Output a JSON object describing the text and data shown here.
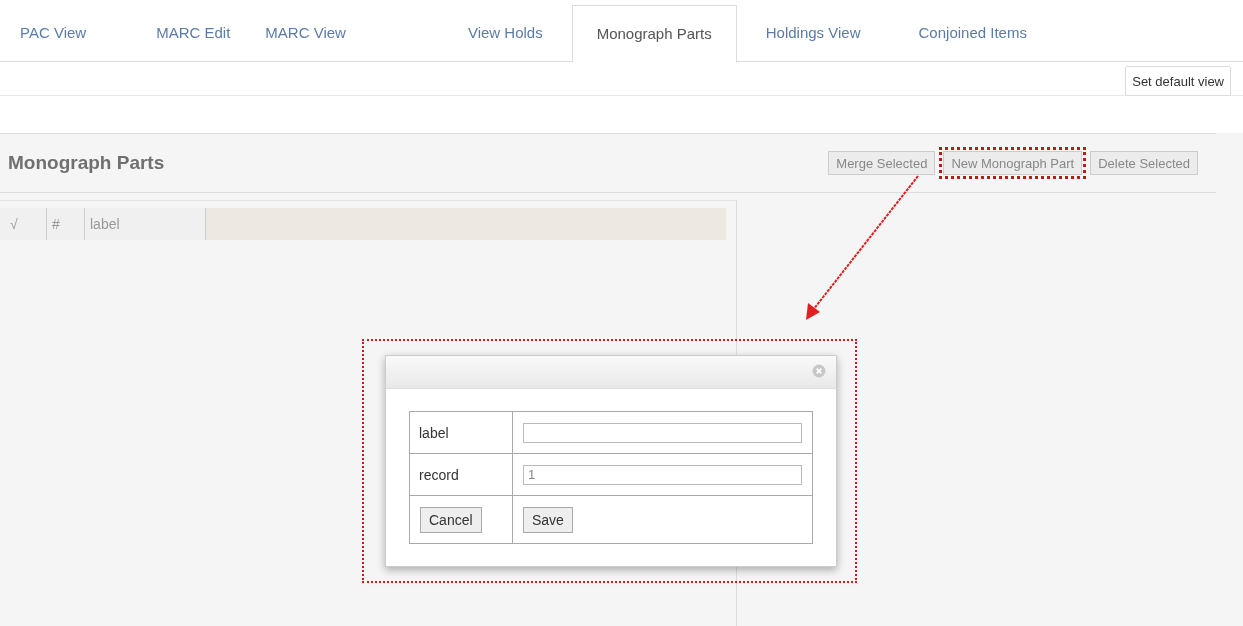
{
  "tabs": [
    {
      "label": "PAC View",
      "selected": false
    },
    {
      "label": "MARC Edit",
      "selected": false
    },
    {
      "label": "MARC View",
      "selected": false
    },
    {
      "label": "View Holds",
      "selected": false
    },
    {
      "label": "Monograph Parts",
      "selected": true
    },
    {
      "label": "Holdings View",
      "selected": false
    },
    {
      "label": "Conjoined Items",
      "selected": false
    }
  ],
  "default_view_button": "Set default view",
  "panel": {
    "title": "Monograph Parts",
    "buttons": [
      {
        "label": "Merge Selected",
        "highlighted": false
      },
      {
        "label": "New Monograph Part",
        "highlighted": true
      },
      {
        "label": "Delete Selected",
        "highlighted": false
      }
    ]
  },
  "table": {
    "columns": [
      "√",
      "#",
      "label"
    ]
  },
  "dialog": {
    "fields": [
      {
        "label": "label"
      },
      {
        "label": "record",
        "value": "1"
      }
    ],
    "buttons": [
      "Cancel",
      "Save"
    ]
  }
}
